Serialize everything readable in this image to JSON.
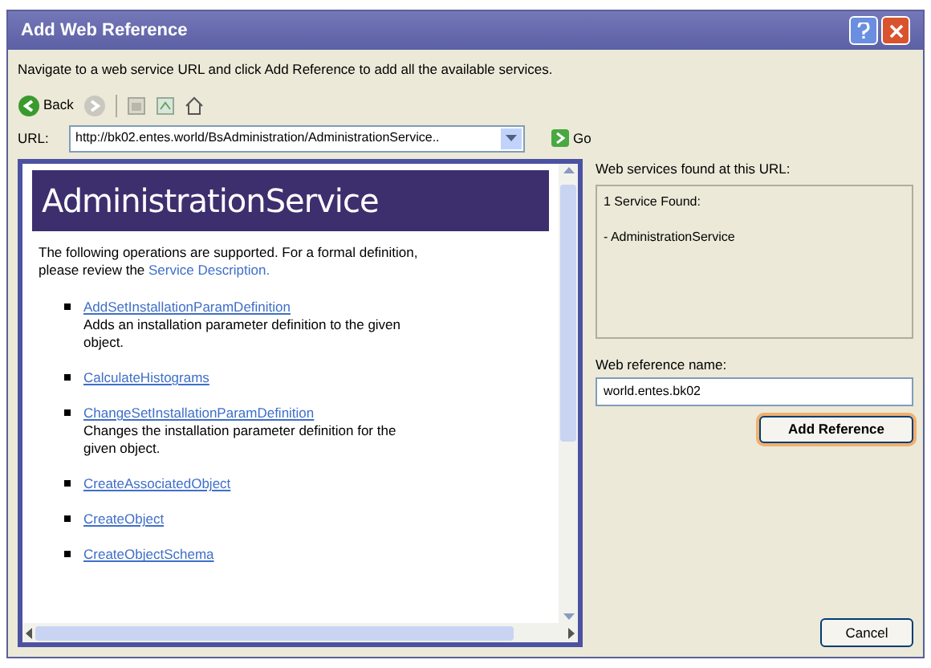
{
  "window": {
    "title": "Add Web Reference"
  },
  "instructions": "Navigate to a web service URL and click Add Reference to add all the available services.",
  "toolbar": {
    "back": {
      "label": "Back",
      "disabled": false
    },
    "forward": {
      "disabled": true
    }
  },
  "url": {
    "label": "URL:",
    "value": "http://bk02.entes.world/BsAdministration/AdministrationService..",
    "go": "Go"
  },
  "page": {
    "heading": "AdministrationService",
    "intro": "The following operations are supported. For a formal definition, please review the ",
    "intro_link": "Service Description.",
    "operations": [
      {
        "name": "AddSetInstallationParamDefinition",
        "description": "Adds an installation parameter definition to the given object."
      },
      {
        "name": "CalculateHistograms"
      },
      {
        "name": "ChangeSetInstallationParamDefinition",
        "description": "Changes the installation parameter definition for the given object."
      },
      {
        "name": "CreateAssociatedObject"
      },
      {
        "name": "CreateObject"
      },
      {
        "name": "CreateObjectSchema"
      }
    ]
  },
  "services": {
    "label": "Web services found at this URL:",
    "lines": [
      "1 Service Found:",
      "- AdministrationService"
    ]
  },
  "reference": {
    "label": "Web reference name:",
    "value": "world.entes.bk02"
  },
  "buttons": {
    "add": "Add Reference",
    "cancel": "Cancel"
  }
}
